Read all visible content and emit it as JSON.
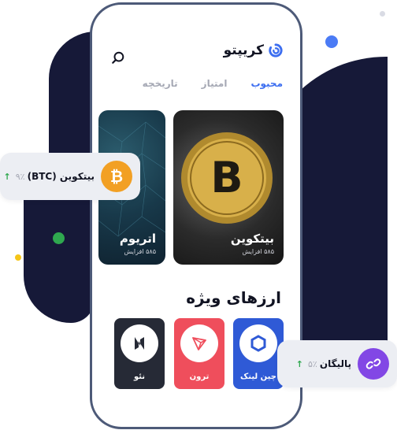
{
  "app": {
    "title": "کریپتو"
  },
  "tabs": [
    {
      "label": "محبوب",
      "active": true
    },
    {
      "label": "امتیاز",
      "active": false
    },
    {
      "label": "تاریخچه",
      "active": false
    }
  ],
  "cards": [
    {
      "title": "بیتکوین",
      "subtitle": "۵۸۵ افزایش"
    },
    {
      "title": "اتریوم",
      "subtitle": "۵۸۵ افزایش"
    }
  ],
  "featured": {
    "title": "ارزهای ویژه",
    "items": [
      {
        "label": "چین لینک",
        "color": "#2f5ad6",
        "icon": "chainlink-icon"
      },
      {
        "label": "ترون",
        "color": "#ef4e5c",
        "icon": "tron-icon"
      },
      {
        "label": "نئو",
        "color": "#262a36",
        "icon": "neo-icon"
      }
    ]
  },
  "pills": {
    "btc": {
      "name": "بیتکوین (BTC)",
      "change": "۹٪",
      "icon": "bitcoin-icon",
      "coin_glyph": "₿"
    },
    "polygon": {
      "name": "پالیگان",
      "change": "۵٪",
      "icon": "polygon-icon"
    }
  },
  "colors": {
    "accent": "#3c6ef0",
    "up": "#2fa84f",
    "bg_dark": "#161938"
  }
}
